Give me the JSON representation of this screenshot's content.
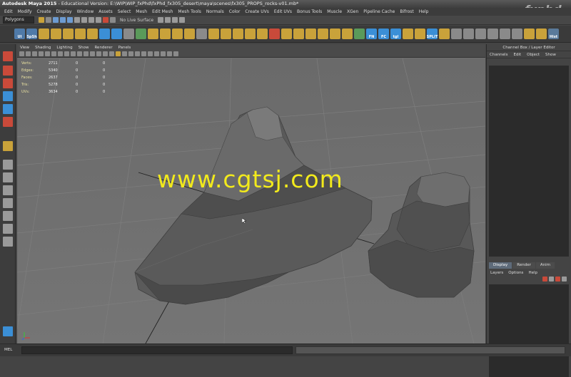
{
  "window": {
    "app": "Autodesk Maya 2015",
    "title_rest": " - Educational Version: E:\\WIP\\WIP_fxPhd\\fxPhd_fx305_desert\\maya\\scenes\\fx305_PROPS_rocks-v01.mb*",
    "brand": "fxphd"
  },
  "menubar": [
    "Edit",
    "Modify",
    "Create",
    "Display",
    "Window",
    "Assets",
    "Select",
    "Mesh",
    "Edit Mesh",
    "Mesh Tools",
    "Normals",
    "Color",
    "Create UVs",
    "Edit UVs",
    "Bonus Tools",
    "Muscle",
    "XGen",
    "Pipeline Cache",
    "Bifrost",
    "Help"
  ],
  "status": {
    "mode": "Polygons",
    "live_surface": "No Live Surface"
  },
  "shelf": {
    "labels": [
      "UI",
      "SpSh",
      "FN",
      "FC",
      "tgl",
      "SPLIT",
      "Hist"
    ]
  },
  "viewport": {
    "menu": [
      "View",
      "Shading",
      "Lighting",
      "Show",
      "Renderer",
      "Panels"
    ],
    "hud": [
      {
        "label": "Verts:",
        "values": [
          "2711",
          "0",
          "0"
        ]
      },
      {
        "label": "Edges:",
        "values": [
          "5340",
          "0",
          "0"
        ]
      },
      {
        "label": "Faces:",
        "values": [
          "2637",
          "0",
          "0"
        ]
      },
      {
        "label": "Tris:",
        "values": [
          "5278",
          "0",
          "0"
        ]
      },
      {
        "label": "UVs:",
        "values": [
          "3634",
          "0",
          "0"
        ]
      }
    ],
    "watermark": "www.cgtsj.com"
  },
  "right_panel": {
    "title": "Channel Box / Layer Editor",
    "menu": [
      "Channels",
      "Edit",
      "Object",
      "Show"
    ],
    "tabs": [
      "Display",
      "Render",
      "Anim"
    ],
    "layer_menu": [
      "Layers",
      "Options",
      "Help"
    ]
  },
  "command_line": {
    "label": "MEL"
  },
  "colors": {
    "accent_blue": "#3b8fd6",
    "shelf_gold": "#c9a23a",
    "watermark_yellow": "#f2ea1c"
  }
}
